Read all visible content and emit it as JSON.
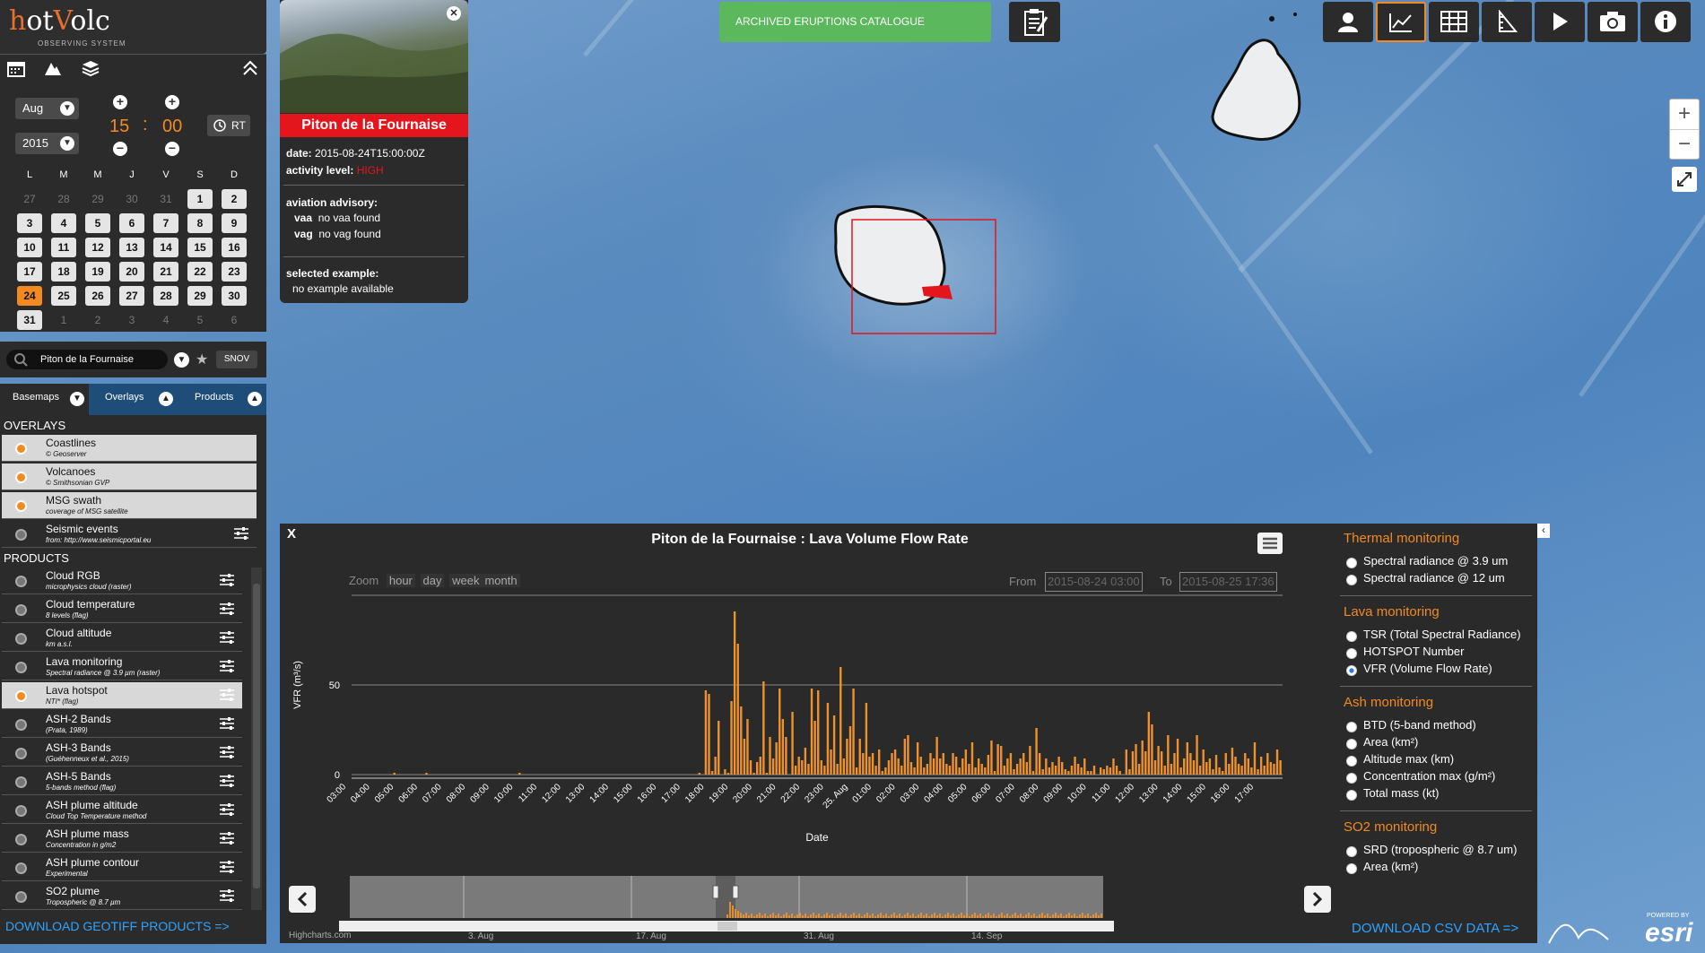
{
  "app": {
    "logo": "HotVolc",
    "subtitle": "OBSERVING SYSTEM"
  },
  "date_picker": {
    "month": "Aug",
    "year": "2015",
    "hour": "15",
    "minute": "00",
    "rt_label": "RT"
  },
  "calendar": {
    "days_header": [
      "L",
      "M",
      "M",
      "J",
      "V",
      "S",
      "D"
    ],
    "rows": [
      [
        {
          "d": "27",
          "s": "dim"
        },
        {
          "d": "28",
          "s": "dim"
        },
        {
          "d": "29",
          "s": "dim"
        },
        {
          "d": "30",
          "s": "dim"
        },
        {
          "d": "31",
          "s": "dim"
        },
        {
          "d": "1",
          "s": "act"
        },
        {
          "d": "2",
          "s": "act"
        }
      ],
      [
        {
          "d": "3",
          "s": "act"
        },
        {
          "d": "4",
          "s": "act"
        },
        {
          "d": "5",
          "s": "act"
        },
        {
          "d": "6",
          "s": "act"
        },
        {
          "d": "7",
          "s": "act"
        },
        {
          "d": "8",
          "s": "act"
        },
        {
          "d": "9",
          "s": "act"
        }
      ],
      [
        {
          "d": "10",
          "s": "act"
        },
        {
          "d": "11",
          "s": "act"
        },
        {
          "d": "12",
          "s": "act"
        },
        {
          "d": "13",
          "s": "act"
        },
        {
          "d": "14",
          "s": "act"
        },
        {
          "d": "15",
          "s": "act"
        },
        {
          "d": "16",
          "s": "act"
        }
      ],
      [
        {
          "d": "17",
          "s": "act"
        },
        {
          "d": "18",
          "s": "act"
        },
        {
          "d": "19",
          "s": "act"
        },
        {
          "d": "20",
          "s": "act"
        },
        {
          "d": "21",
          "s": "act"
        },
        {
          "d": "22",
          "s": "act"
        },
        {
          "d": "23",
          "s": "act"
        }
      ],
      [
        {
          "d": "24",
          "s": "today"
        },
        {
          "d": "25",
          "s": "act"
        },
        {
          "d": "26",
          "s": "act"
        },
        {
          "d": "27",
          "s": "act"
        },
        {
          "d": "28",
          "s": "act"
        },
        {
          "d": "29",
          "s": "act"
        },
        {
          "d": "30",
          "s": "act"
        }
      ],
      [
        {
          "d": "31",
          "s": "act"
        },
        {
          "d": "1",
          "s": "dim"
        },
        {
          "d": "2",
          "s": "dim"
        },
        {
          "d": "3",
          "s": "dim"
        },
        {
          "d": "4",
          "s": "dim"
        },
        {
          "d": "5",
          "s": "dim"
        },
        {
          "d": "6",
          "s": "dim"
        }
      ]
    ]
  },
  "search": {
    "value": "Piton de la Fournaise",
    "snov_label": "SNOV"
  },
  "layer_tabs": {
    "basemaps": "Basemaps",
    "overlays": "Overlays",
    "products": "Products"
  },
  "overlays": {
    "title": "OVERLAYS",
    "items": [
      {
        "name": "Coastlines",
        "sub": "© Geoserver",
        "on": true,
        "light": true,
        "cfg": false
      },
      {
        "name": "Volcanoes",
        "sub": "© Smithsonian GVP",
        "on": true,
        "light": true,
        "cfg": false
      },
      {
        "name": "MSG swath",
        "sub": "coverage of MSG satellite",
        "on": true,
        "light": true,
        "cfg": false
      },
      {
        "name": "Seismic events",
        "sub": "from: http://www.seismicportal.eu",
        "on": false,
        "light": false,
        "cfg": true
      }
    ]
  },
  "products": {
    "title": "PRODUCTS",
    "items": [
      {
        "name": "Cloud RGB",
        "sub": "microphysics cloud (raster)",
        "on": false,
        "light": false
      },
      {
        "name": "Cloud temperature",
        "sub": "8 levels (flag)",
        "on": false,
        "light": false
      },
      {
        "name": "Cloud altitude",
        "sub": "km a.s.l.",
        "on": false,
        "light": false
      },
      {
        "name": "Lava monitoring",
        "sub": "Spectral radiance @ 3.9 µm (raster)",
        "on": false,
        "light": false
      },
      {
        "name": "Lava hotspot",
        "sub": "NTI* (flag)",
        "on": true,
        "light": true
      },
      {
        "name": "ASH-2 Bands",
        "sub": "(Prata, 1989)",
        "on": false,
        "light": false
      },
      {
        "name": "ASH-3 Bands",
        "sub": "(Guéhenneux et al., 2015)",
        "on": false,
        "light": false
      },
      {
        "name": "ASH-5 Bands",
        "sub": "5-bands method (flag)",
        "on": false,
        "light": false
      },
      {
        "name": "ASH plume altitude",
        "sub": "Cloud Top Temperature method",
        "on": false,
        "light": false
      },
      {
        "name": "ASH plume mass",
        "sub": "Concentration in g/m2",
        "on": false,
        "light": false
      },
      {
        "name": "ASH plume contour",
        "sub": "Experimental",
        "on": false,
        "light": false
      },
      {
        "name": "SO2 plume",
        "sub": "Tropospheric @ 8.7 µm",
        "on": false,
        "light": false
      }
    ],
    "download": "DOWNLOAD GEOTIFF PRODUCTS =>"
  },
  "popup": {
    "title": "Piton de la Fournaise",
    "date_label": "date:",
    "date_value": "2015-08-24T15:00:00Z",
    "activity_label": "activity level:",
    "activity_value": "HIGH",
    "aviation_label": "aviation advisory:",
    "vaa_label": "vaa",
    "vaa_value": "no vaa found",
    "vag_label": "vag",
    "vag_value": "no vag found",
    "example_label": "selected example:",
    "example_value": "no example available"
  },
  "top": {
    "archived": "ARCHIVED ERUPTIONS CATALOGUE"
  },
  "chart_panel": {
    "close": "X",
    "zoom_label": "Zoom",
    "zoom_options": [
      "hour",
      "day",
      "week",
      "month"
    ],
    "from_label": "From",
    "from_value": "2015-08-24 03:00",
    "to_label": "To",
    "to_value": "2015-08-25 17:36",
    "credit": "Highcharts.com",
    "nav_labels": [
      "3. Aug",
      "17. Aug",
      "31. Aug",
      "14. Sep"
    ]
  },
  "chart_data": {
    "type": "bar",
    "title": "Piton de la Fournaise : Lava Volume Flow Rate",
    "xlabel": "Date",
    "ylabel": "VFR (m³/s)",
    "ylim": [
      0,
      100
    ],
    "yticks": [
      0,
      50
    ],
    "grid": true,
    "color": "#f0922b",
    "x_ticks": [
      "03:00",
      "04:00",
      "05:00",
      "06:00",
      "07:00",
      "08:00",
      "09:00",
      "10:00",
      "11:00",
      "12:00",
      "13:00",
      "14:00",
      "15:00",
      "16:00",
      "17:00",
      "18:00",
      "19:00",
      "20:00",
      "21:00",
      "22:00",
      "23:00",
      "25. Aug",
      "01:00",
      "02:00",
      "03:00",
      "04:00",
      "05:00",
      "06:00",
      "07:00",
      "08:00",
      "09:00",
      "10:00",
      "11:00",
      "12:00",
      "13:00",
      "14:00",
      "15:00",
      "16:00",
      "17:00"
    ],
    "values": [
      0,
      0,
      0,
      0,
      0,
      0,
      0,
      0,
      0,
      0,
      0,
      0,
      0,
      1,
      0,
      0,
      0,
      0,
      0,
      0,
      0,
      0,
      0,
      1,
      0,
      0,
      0,
      0,
      0,
      0,
      0,
      0,
      0,
      0,
      0,
      0,
      0,
      0,
      0,
      0,
      0,
      0,
      0,
      0,
      0,
      0,
      0,
      0,
      0,
      0,
      0,
      0,
      1,
      0,
      0,
      0,
      0,
      0,
      0,
      0,
      0,
      0,
      0,
      0,
      0,
      0,
      0,
      0,
      0,
      0,
      0,
      0,
      0,
      0,
      0,
      0,
      0,
      0,
      0,
      0,
      0,
      0,
      0,
      0,
      0,
      0,
      0,
      0,
      0,
      0,
      0,
      0,
      0,
      0,
      0,
      0,
      0,
      0,
      0,
      0,
      0,
      0,
      0,
      0,
      0,
      0,
      0,
      0,
      1,
      0,
      47,
      45,
      2,
      10,
      30,
      0,
      3,
      1,
      41,
      91,
      73,
      38,
      20,
      31,
      8,
      1,
      7,
      10,
      52,
      1,
      21,
      9,
      18,
      48,
      31,
      21,
      0,
      35,
      5,
      10,
      8,
      15,
      6,
      48,
      30,
      47,
      8,
      5,
      40,
      14,
      33,
      6,
      60,
      9,
      20,
      27,
      48,
      4,
      20,
      12,
      40,
      10,
      12,
      5,
      14,
      2,
      4,
      8,
      12,
      14,
      9,
      5,
      20,
      22,
      7,
      4,
      18,
      10,
      4,
      6,
      12,
      9,
      21,
      9,
      12,
      6,
      5,
      12,
      10,
      4,
      9,
      14,
      6,
      18,
      4,
      9,
      6,
      4,
      11,
      19,
      2,
      17,
      16,
      5,
      9,
      12,
      3,
      6,
      9,
      12,
      7,
      16,
      2,
      26,
      12,
      3,
      9,
      4,
      7,
      5,
      10,
      7,
      3,
      2,
      5,
      10,
      6,
      4,
      9,
      2,
      2,
      5,
      0,
      4,
      3,
      5,
      4,
      9,
      5,
      2,
      0,
      14,
      3,
      13,
      17,
      6,
      19,
      13,
      35,
      28,
      8,
      16,
      13,
      5,
      22,
      6,
      12,
      20,
      4,
      9,
      18,
      12,
      8,
      22,
      5,
      14,
      7,
      9,
      3,
      11,
      4,
      2,
      12,
      6,
      15,
      10,
      6,
      5,
      12,
      9,
      4,
      18,
      3,
      10,
      5,
      12,
      7,
      6,
      14,
      8
    ]
  },
  "right_controls": {
    "thermal": {
      "title": "Thermal monitoring",
      "items": [
        "Spectral radiance @ 3.9 um",
        "Spectral radiance @ 12 um"
      ]
    },
    "lava": {
      "title": "Lava monitoring",
      "items": [
        "TSR (Total Spectral Radiance)",
        "HOTSPOT Number",
        "VFR (Volume Flow Rate)"
      ],
      "selected": 2
    },
    "ash": {
      "title": "Ash monitoring",
      "items": [
        "BTD (5-band method)",
        "Area (km²)",
        "Altitude max (km)",
        "Concentration max (g/m²)",
        "Total mass (kt)"
      ]
    },
    "so2": {
      "title": "SO2 monitoring",
      "items": [
        "SRD (tropospheric @ 8.7 um)",
        "Area (km²)"
      ]
    },
    "download": "DOWNLOAD CSV DATA =>",
    "esri": "esri",
    "esri_powered": "POWERED BY"
  },
  "colors": {
    "accent": "#f28a1f",
    "danger": "#e4151c",
    "link": "#2fa3ff",
    "panel": "#2b2b2b"
  }
}
